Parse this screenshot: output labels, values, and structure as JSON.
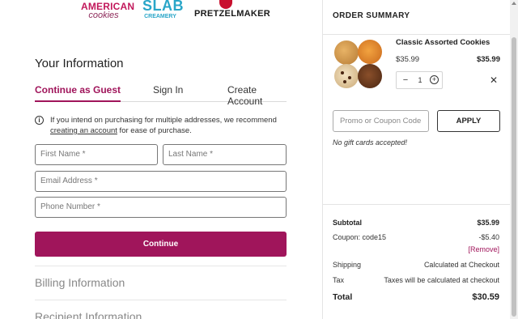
{
  "brands": {
    "aac_line1": "AMERICAN",
    "aac_line2": "cookies",
    "slab_line1": "SLAB",
    "slab_line2": "CREAMERY",
    "pretzel_line1": "PRETZELMAKER"
  },
  "info": {
    "title": "Your Information",
    "tabs": [
      "Continue as Guest",
      "Sign In",
      "Create Account"
    ],
    "active_tab": "Continue as Guest",
    "notice_text": "If you intend on purchasing for multiple addresses, we recommend",
    "notice_link": "creating an account",
    "notice_tail": " for ease of purchase.",
    "fields": {
      "first_name": "First Name *",
      "last_name": "Last Name *",
      "email": "Email Address *",
      "phone": "Phone Number *"
    },
    "continue_label": "Continue",
    "sections": [
      "Billing Information",
      "Recipient Information"
    ]
  },
  "order_summary": {
    "title": "ORDER SUMMARY",
    "item": {
      "name": "Classic Assorted Cookies",
      "price": "$35.99",
      "total": "$35.99",
      "quantity": "1",
      "remove_symbol": "✕"
    },
    "promo_placeholder": "Promo or Coupon Code",
    "apply_label": "APPLY",
    "gift_note": "No gift cards accepted!",
    "subtotal_label": "Subtotal",
    "subtotal_value": "$35.99",
    "coupon_label": "Coupon: code15",
    "coupon_value": "-$5.40",
    "remove_label": "[Remove]",
    "shipping_label": "Shipping",
    "shipping_value": "Calculated at Checkout",
    "tax_label": "Tax",
    "tax_value": "Taxes will be calculated at checkout",
    "total_label": "Total",
    "total_value": "$30.59"
  },
  "colors": {
    "accent": "#a0155b",
    "border": "#777777"
  }
}
